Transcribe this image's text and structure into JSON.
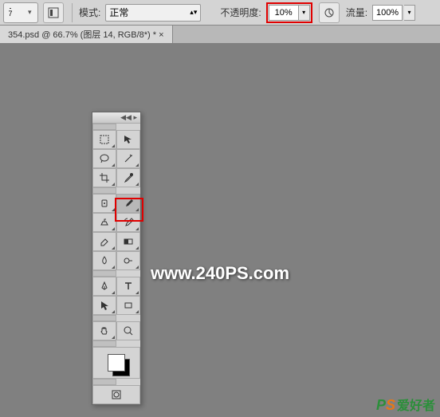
{
  "options_bar": {
    "brush_size": "7",
    "mode_label": "模式:",
    "mode_value": "正常",
    "opacity_label": "不透明度:",
    "opacity_value": "10%",
    "flow_label": "流量:",
    "flow_value": "100%"
  },
  "doc_tab": "354.psd @ 66.7% (图层 14, RGB/8*) * ×",
  "tools_header": "◀◀  ▸",
  "watermark_main": "www.240PS.com",
  "watermark_corner": {
    "p": "P",
    "s": "S",
    "cn": "爱好者"
  },
  "colors": {
    "highlight": "#e00000",
    "fg_swatch": "#ffffff",
    "bg_swatch": "#000000"
  }
}
